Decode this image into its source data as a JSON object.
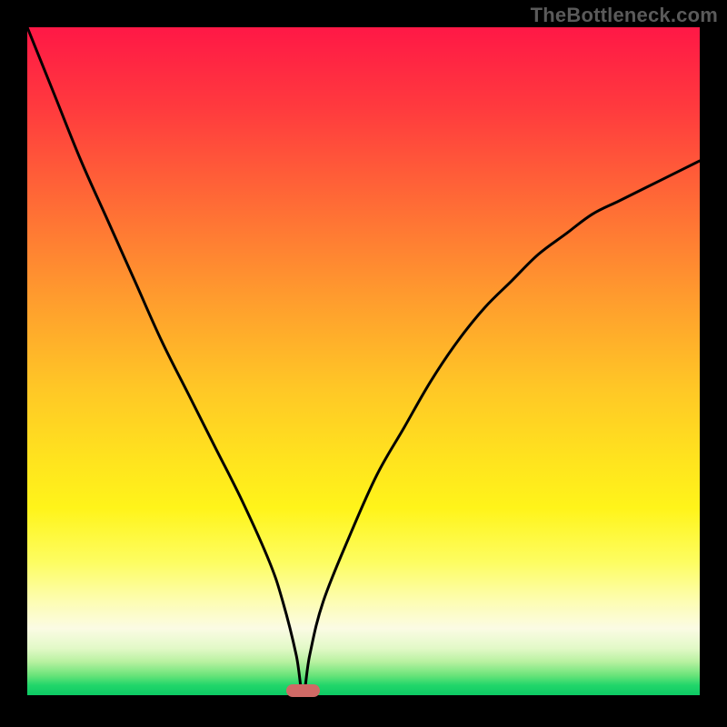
{
  "watermark": "TheBottleneck.com",
  "colors": {
    "frame": "#000000",
    "curve": "#000000",
    "marker": "#cf6a66",
    "watermark": "#5a5a5a",
    "gradient_top": "#ff1846",
    "gradient_mid": "#ffe41e",
    "gradient_bottom": "#0cc964"
  },
  "chart_data": {
    "type": "line",
    "title": "",
    "xlabel": "",
    "ylabel": "",
    "xlim": [
      0,
      100
    ],
    "ylim": [
      0,
      100
    ],
    "grid": false,
    "legend": false,
    "series": [
      {
        "name": "bottleneck-curve",
        "x": [
          0,
          4,
          8,
          12,
          16,
          20,
          24,
          28,
          32,
          36,
          38,
          40,
          41,
          42,
          44,
          48,
          52,
          56,
          60,
          64,
          68,
          72,
          76,
          80,
          84,
          88,
          92,
          96,
          100
        ],
        "y": [
          100,
          90,
          80,
          71,
          62,
          53,
          45,
          37,
          29,
          20,
          14,
          6,
          0,
          6,
          14,
          24,
          33,
          40,
          47,
          53,
          58,
          62,
          66,
          69,
          72,
          74,
          76,
          78,
          80
        ]
      }
    ],
    "annotations": [
      {
        "name": "optimal-marker",
        "x": 41,
        "y": 0,
        "width_pct": 5,
        "shape": "pill",
        "color": "#cf6a66"
      }
    ]
  }
}
